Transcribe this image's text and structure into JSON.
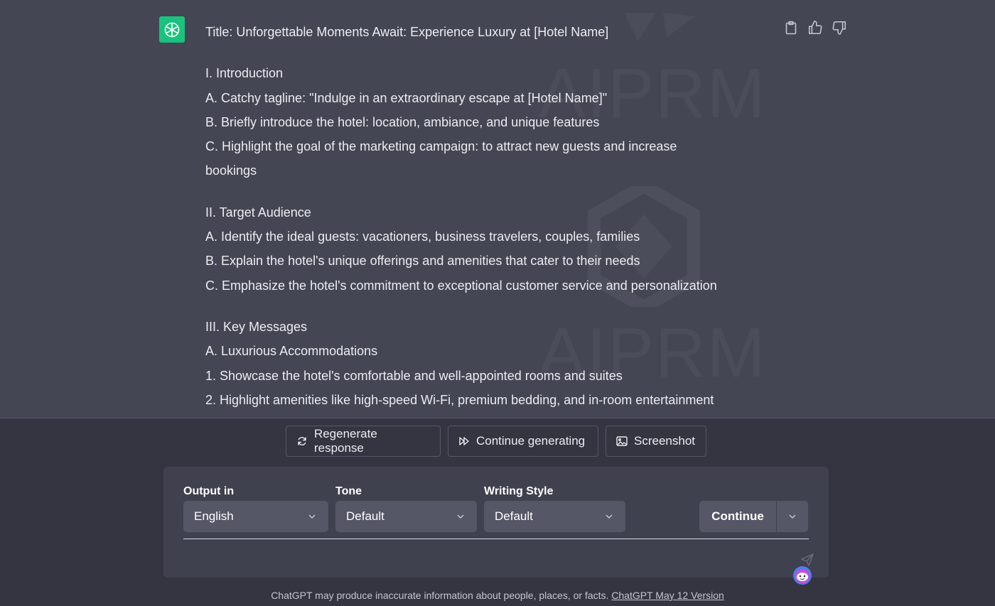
{
  "message": {
    "lines": [
      "Title: Unforgettable Moments Await: Experience Luxury at [Hotel Name]",
      "",
      "I. Introduction",
      "A. Catchy tagline: \"Indulge in an extraordinary escape at [Hotel Name]\"",
      "B. Briefly introduce the hotel: location, ambiance, and unique features",
      "C. Highlight the goal of the marketing campaign: to attract new guests and increase",
      "bookings",
      "",
      "II. Target Audience",
      "A. Identify the ideal guests: vacationers, business travelers, couples, families",
      "B. Explain the hotel's unique offerings and amenities that cater to their needs",
      "C. Emphasize the hotel's commitment to exceptional customer service and personalization",
      "",
      "III. Key Messages",
      "A. Luxurious Accommodations",
      "1. Showcase the hotel's comfortable and well-appointed rooms and suites",
      "2. Highlight amenities like high-speed Wi-Fi, premium bedding, and in-room entertainment"
    ],
    "avatar_icon": "openai-logo-icon",
    "avatar_color": "#19c37d"
  },
  "watermark": {
    "text_1": "AIPRM",
    "text_2": "AIPRM"
  },
  "actions": {
    "copy_icon": "clipboard-icon",
    "like_icon": "thumbs-up-icon",
    "dislike_icon": "thumbs-down-icon"
  },
  "buttons": {
    "regenerate": "Regenerate response",
    "continue_generating": "Continue generating",
    "screenshot": "Screenshot"
  },
  "prompt_panel": {
    "output_label": "Output in",
    "output_value": "English",
    "tone_label": "Tone",
    "tone_value": "Default",
    "style_label": "Writing Style",
    "style_value": "Default",
    "continue_label": "Continue"
  },
  "footer": {
    "text": "ChatGPT may produce inaccurate information about people, places, or facts. ",
    "link": "ChatGPT May 12 Version"
  }
}
